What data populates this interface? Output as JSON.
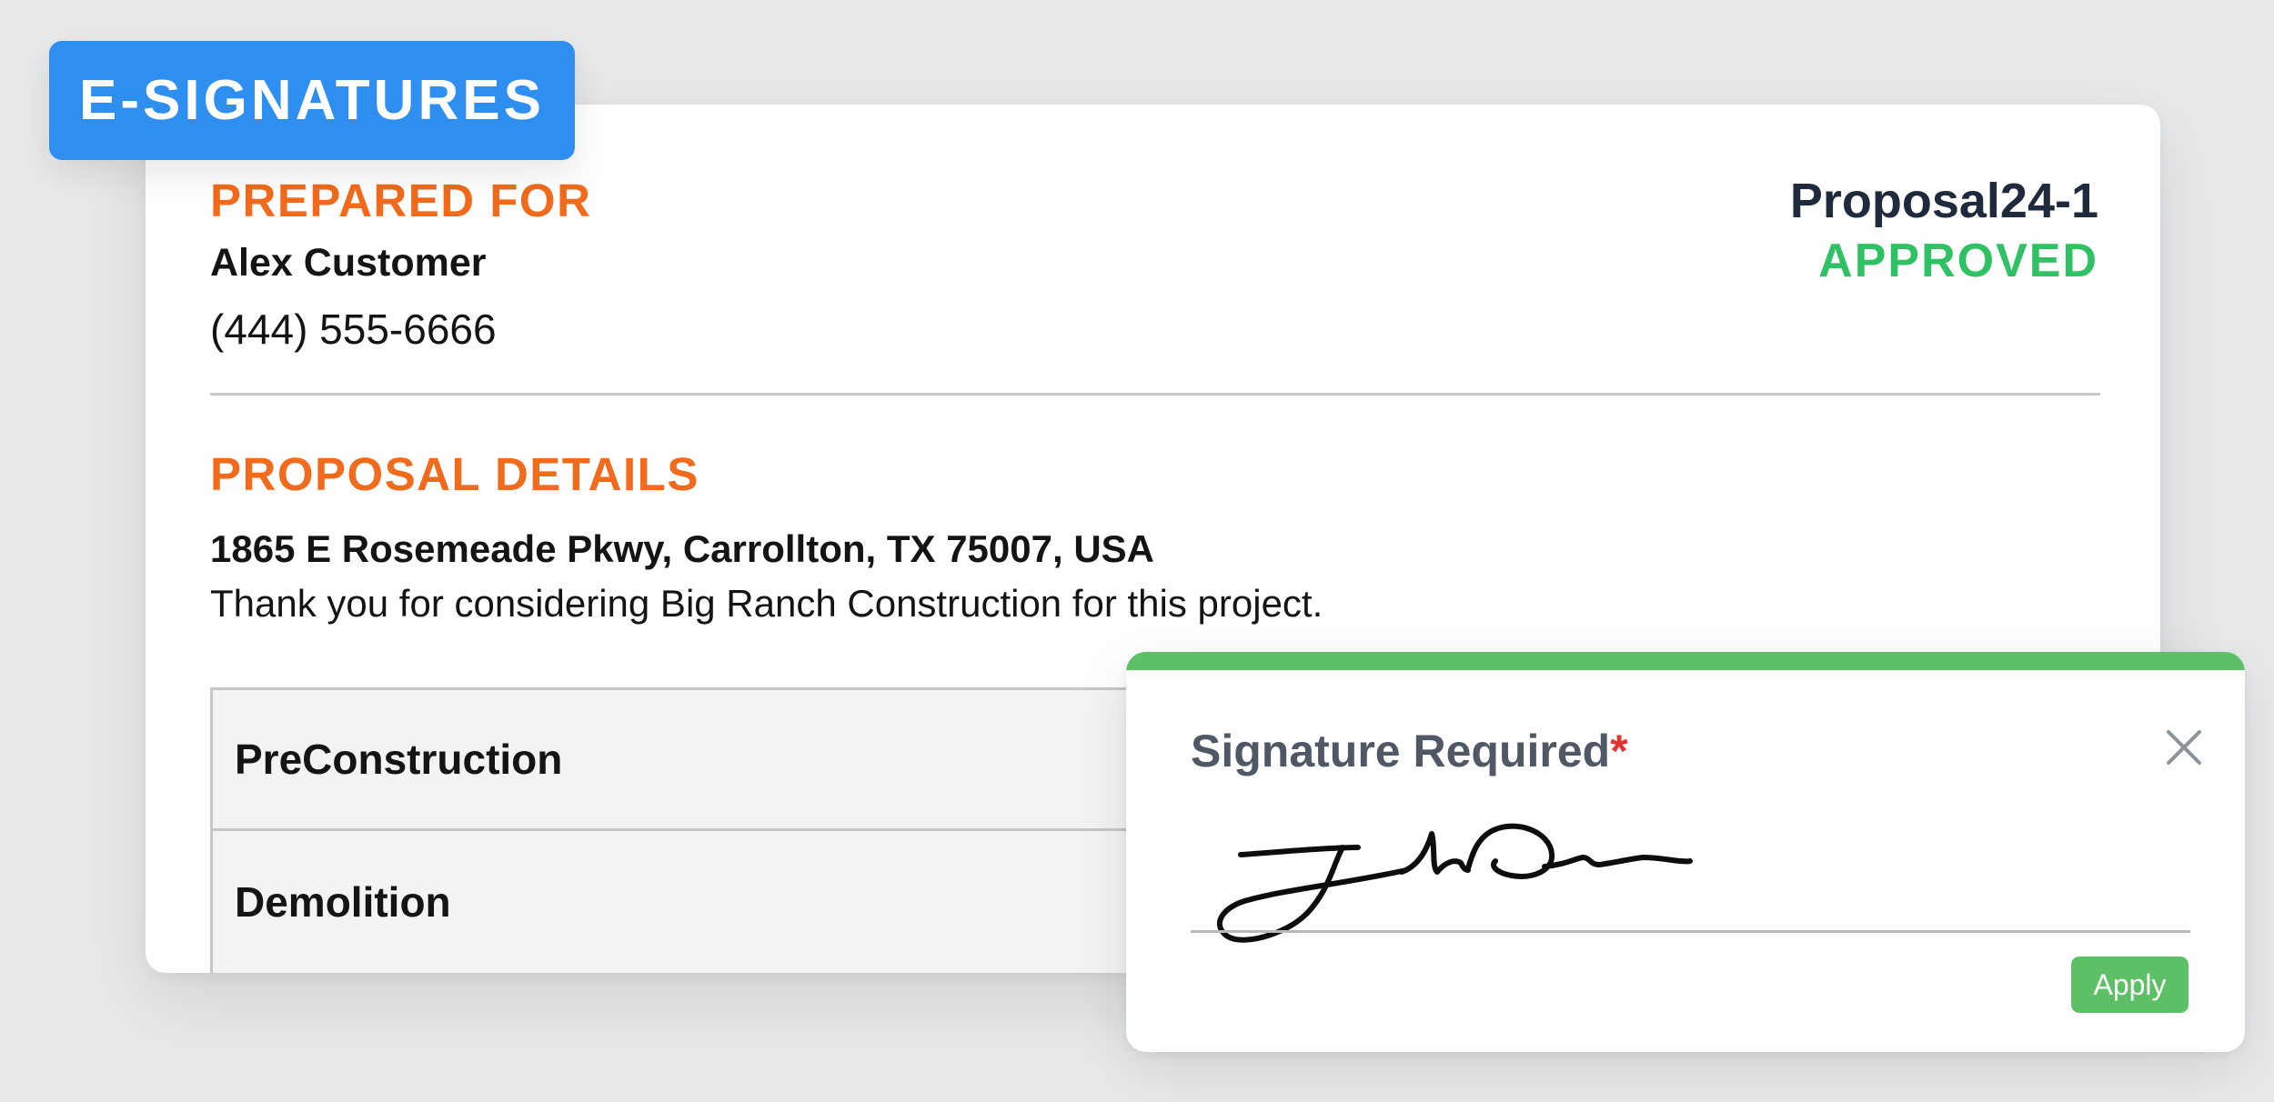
{
  "badge": {
    "label": "E-SIGNATURES"
  },
  "prepared_for": {
    "heading": "PREPARED FOR",
    "name": "Alex Customer",
    "phone": "(444) 555-6666"
  },
  "proposal": {
    "id": "Proposal24-1",
    "status": "APPROVED"
  },
  "details": {
    "heading": "PROPOSAL DETAILS",
    "address": "1865 E Rosemeade Pkwy, Carrollton, TX 75007, USA",
    "message": "Thank you for considering Big Ranch Construction for this project."
  },
  "phases": [
    {
      "name": "PreConstruction"
    },
    {
      "name": "Demolition"
    }
  ],
  "signature_modal": {
    "title": "Signature Required",
    "required_mark": "*",
    "apply_label": "Apply",
    "close_icon": "close-icon"
  },
  "colors": {
    "accent_orange": "#f26a1b",
    "approved_green": "#2fc163",
    "badge_blue": "#2e8ff0",
    "modal_green": "#5dbf66",
    "required_red": "#e03333"
  }
}
